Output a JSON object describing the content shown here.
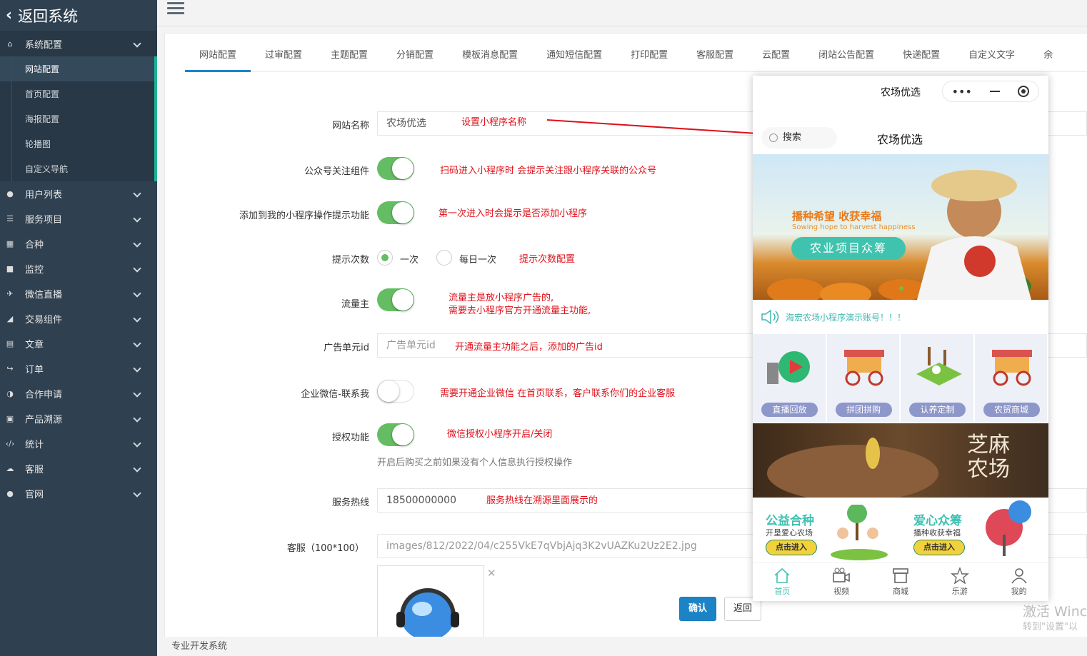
{
  "sidebar": {
    "back_label": "返回系统",
    "groups": [
      {
        "label": "系统配置"
      },
      {
        "label": "用户列表"
      },
      {
        "label": "服务项目"
      },
      {
        "label": "合种"
      },
      {
        "label": "监控"
      },
      {
        "label": "微信直播"
      },
      {
        "label": "交易组件"
      },
      {
        "label": "文章"
      },
      {
        "label": "订单"
      },
      {
        "label": "合作申请"
      },
      {
        "label": "产品溯源"
      },
      {
        "label": "统计"
      },
      {
        "label": "客服"
      },
      {
        "label": "官网"
      }
    ],
    "sub_items": [
      {
        "label": "网站配置"
      },
      {
        "label": "首页配置"
      },
      {
        "label": "海报配置"
      },
      {
        "label": "轮播图"
      },
      {
        "label": "自定义导航"
      }
    ]
  },
  "tabs": [
    {
      "label": "网站配置"
    },
    {
      "label": "过审配置"
    },
    {
      "label": "主题配置"
    },
    {
      "label": "分销配置"
    },
    {
      "label": "模板消息配置"
    },
    {
      "label": "通知短信配置"
    },
    {
      "label": "打印配置"
    },
    {
      "label": "客服配置"
    },
    {
      "label": "云配置"
    },
    {
      "label": "闭站公告配置"
    },
    {
      "label": "快递配置"
    },
    {
      "label": "自定义文字"
    },
    {
      "label": "余"
    }
  ],
  "form": {
    "site_name": {
      "label": "网站名称",
      "value": "农场优选",
      "note": "设置小程序名称"
    },
    "follow_component": {
      "label": "公众号关注组件",
      "on": true,
      "note": "扫码进入小程序时 会提示关注跟小程序关联的公众号"
    },
    "add_prompt": {
      "label": "添加到我的小程序操作提示功能",
      "on": true,
      "note": "第一次进入时会提示是否添加小程序"
    },
    "prompt_count": {
      "label": "提示次数",
      "options": [
        "一次",
        "每日一次"
      ],
      "selected": "一次",
      "note": "提示次数配置"
    },
    "traffic_owner": {
      "label": "流量主",
      "on": true,
      "note_line1": "流量主是放小程序广告的,",
      "note_line2": "需要去小程序官方开通流量主功能,"
    },
    "ad_unit": {
      "label": "广告单元id",
      "placeholder": "广告单元id",
      "note": "开通流量主功能之后，添加的广告id"
    },
    "wecom_contact": {
      "label": "企业微信-联系我",
      "on": false,
      "note": "需要开通企业微信   在首页联系，客户联系你们的企业客服"
    },
    "authorize": {
      "label": "授权功能",
      "on": true,
      "note": "微信授权小程序开启/关闭",
      "help": "开启后购买之前如果没有个人信息执行授权操作"
    },
    "hotline": {
      "label": "服务热线",
      "value": "18500000000",
      "note": "服务热线在溯源里面展示的"
    },
    "service_image": {
      "label": "客服（100*100）",
      "value": "images/812/2022/04/c255VkE7qVbjAjq3K2vUAZKu2Uz2E2.jpg"
    }
  },
  "buttons": {
    "confirm": "确认",
    "back": "返回"
  },
  "phone": {
    "title": "农场优选",
    "search": "搜索",
    "name": "农场优选",
    "banner_title": "播种希望 收获幸福",
    "banner_sub": "Sowing hope to harvest happiness",
    "banner_pill": "农业项目众筹",
    "notice": "海宏农场小程序演示账号！！！",
    "grid": [
      {
        "label": "直播回放"
      },
      {
        "label": "拼团拼购"
      },
      {
        "label": "认养定制"
      },
      {
        "label": "农贸商城"
      }
    ],
    "sesame_line1": "芝麻",
    "sesame_line2": "农场",
    "promo_left": {
      "title": "公益合种",
      "sub": "开垦爱心农场",
      "btn": "点击进入"
    },
    "promo_right": {
      "title": "爱心众筹",
      "sub": "播种收获幸福",
      "btn": "点击进入"
    },
    "tabbar": [
      {
        "label": "首页"
      },
      {
        "label": "视频"
      },
      {
        "label": "商城"
      },
      {
        "label": "乐游"
      },
      {
        "label": "我的"
      }
    ]
  },
  "footer": "专业开发系统",
  "watermark": {
    "line1": "激活 Winc",
    "line2": "转到\"设置\"以"
  },
  "colors": {
    "sidebar": "#2f4050",
    "accent": "#1c84c6",
    "toggle_on": "#64bd63",
    "note": "#e0101a",
    "teal": "#3fc1b1"
  }
}
